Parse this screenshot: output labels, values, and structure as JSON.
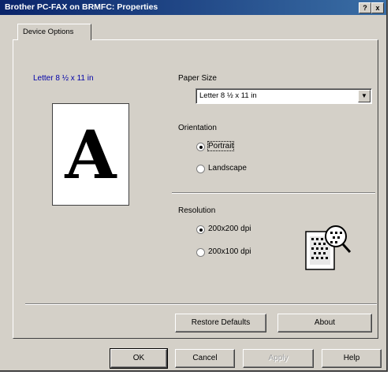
{
  "window": {
    "title": "Brother PC-FAX on BRMFC: Properties",
    "help_glyph": "?",
    "close_glyph": "x"
  },
  "tabs": [
    {
      "label": "Device Options"
    }
  ],
  "preview": {
    "paper_label": "Letter 8 ½ x 11 in",
    "letter": "A"
  },
  "paper_size": {
    "label": "Paper Size",
    "value": "Letter 8 ½ x 11 in",
    "dropdown_glyph": "▼"
  },
  "orientation": {
    "label": "Orientation",
    "options": [
      {
        "label": "Portrait",
        "selected": true
      },
      {
        "label": "Landscape",
        "selected": false
      }
    ]
  },
  "resolution": {
    "label": "Resolution",
    "options": [
      {
        "label": "200x200 dpi",
        "selected": true
      },
      {
        "label": "200x100 dpi",
        "selected": false
      }
    ]
  },
  "panel_buttons": {
    "restore_defaults": "Restore Defaults",
    "about": "About"
  },
  "dialog_buttons": {
    "ok": "OK",
    "cancel": "Cancel",
    "apply": "Apply",
    "help": "Help"
  }
}
